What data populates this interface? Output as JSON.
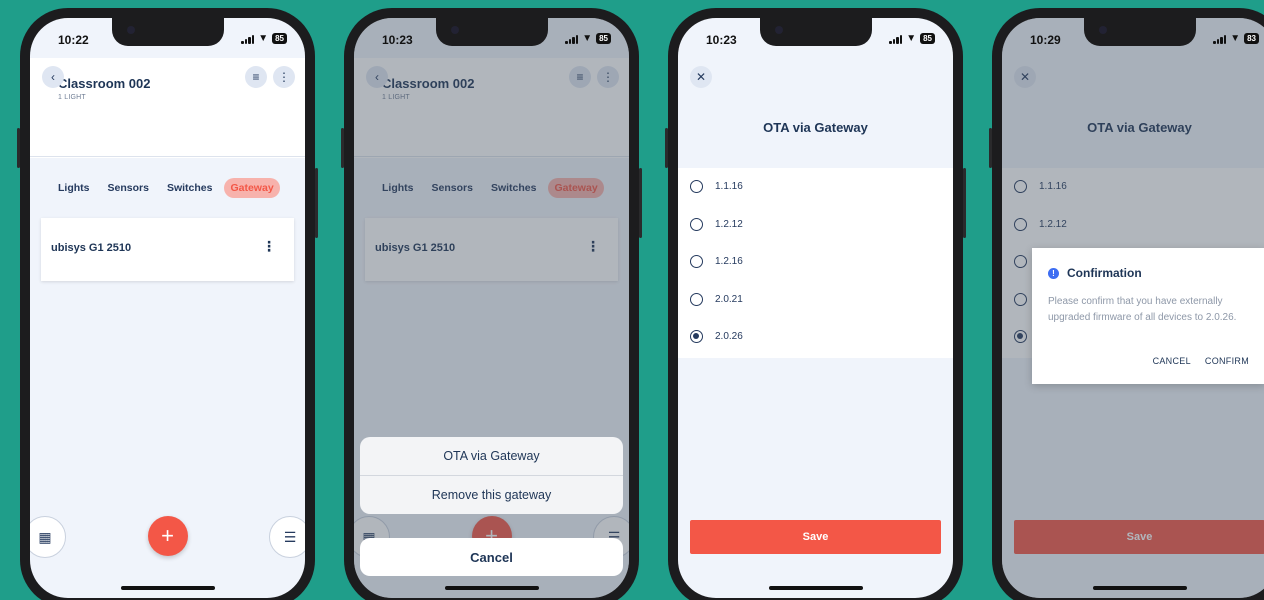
{
  "colors": {
    "background": "#1f9e8a",
    "accent": "#f35747",
    "navy": "#1e3556"
  },
  "screen1": {
    "time": "10:22",
    "battery": "85",
    "room_title": "Classroom 002",
    "room_subtitle": "1 LIGHT",
    "tabs": [
      "Lights",
      "Sensors",
      "Switches",
      "Gateway"
    ],
    "active_tab": "Gateway",
    "gateway_name": "ubisys G1 2510",
    "icons": [
      "back-chevron-icon",
      "filter-sliders-icon",
      "more-vertical-icon",
      "building-icon",
      "plus-icon",
      "menu-icon"
    ]
  },
  "screen2": {
    "time": "10:23",
    "battery": "85",
    "room_title": "Classroom 002",
    "room_subtitle": "1 LIGHT",
    "tabs": [
      "Lights",
      "Sensors",
      "Switches",
      "Gateway"
    ],
    "gateway_name": "ubisys G1 2510",
    "sheet": {
      "options": [
        "OTA via Gateway",
        "Remove this gateway"
      ],
      "cancel": "Cancel"
    }
  },
  "screen3": {
    "time": "10:23",
    "battery": "85",
    "title": "OTA via Gateway",
    "versions": [
      "1.1.16",
      "1.2.12",
      "1.2.16",
      "2.0.21",
      "2.0.26"
    ],
    "selected_version": "2.0.26",
    "save_label": "Save"
  },
  "screen4": {
    "time": "10:29",
    "battery": "83",
    "title": "OTA via Gateway",
    "versions": [
      "1.1.16",
      "1.2.12"
    ],
    "save_label": "Save",
    "dialog": {
      "title": "Confirmation",
      "message": "Please confirm that you have externally upgraded firmware of all devices to 2.0.26.",
      "cancel": "CANCEL",
      "confirm": "CONFIRM"
    }
  }
}
